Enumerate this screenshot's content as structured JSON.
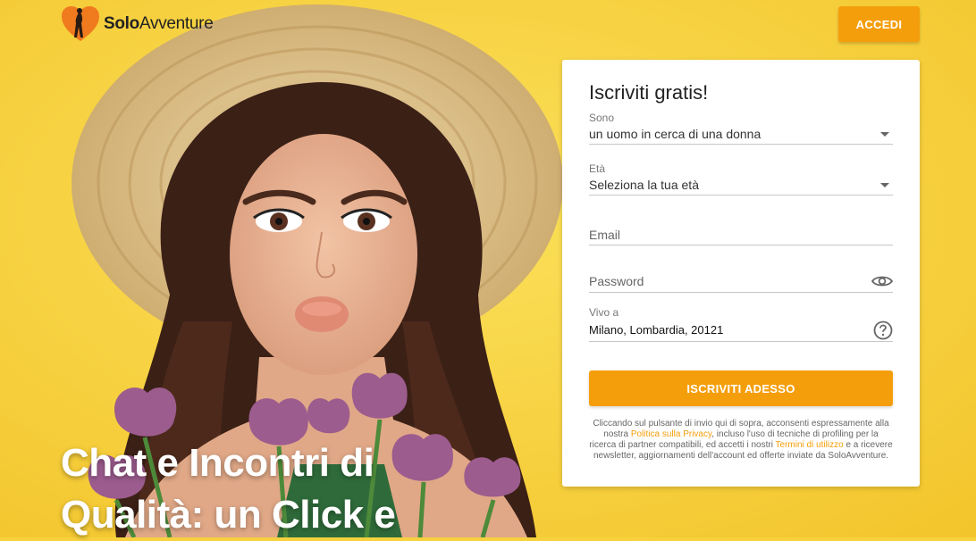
{
  "brand": {
    "name_bold": "Solo",
    "name_light": "Avventure"
  },
  "header": {
    "login_label": "ACCEDI"
  },
  "hero": {
    "headline_line1": "Chat e Incontri di",
    "headline_line2": "Qualità: un Click e"
  },
  "form": {
    "title": "Iscriviti gratis!",
    "sono": {
      "label": "Sono",
      "value": "un uomo in cerca di una donna"
    },
    "eta": {
      "label": "Età",
      "value": "Seleziona la tua età"
    },
    "email": {
      "placeholder": "Email"
    },
    "password": {
      "placeholder": "Password"
    },
    "vivo": {
      "label": "Vivo a",
      "value": "Milano, Lombardia, 20121"
    },
    "submit_label": "ISCRIVITI ADESSO",
    "legal": {
      "part1": "Cliccando sul pulsante di invio qui di sopra, acconsenti espressamente alla nostra ",
      "privacy_link": "Politica sulla Privacy",
      "part2": ", incluso l'uso di tecniche di profiling per la ricerca di partner compatibili, ed accetti i nostri ",
      "terms_link": "Termini di utilizzo",
      "part3": " e a ricevere newsletter, aggiornamenti dell'account ed offerte inviate da SoloAvventure."
    }
  },
  "colors": {
    "accent": "#f59e0b",
    "background": "#f7d23e"
  },
  "icons": {
    "password_toggle": "eye-icon",
    "location_help": "question-circle-icon",
    "select_caret": "caret-down-icon"
  }
}
